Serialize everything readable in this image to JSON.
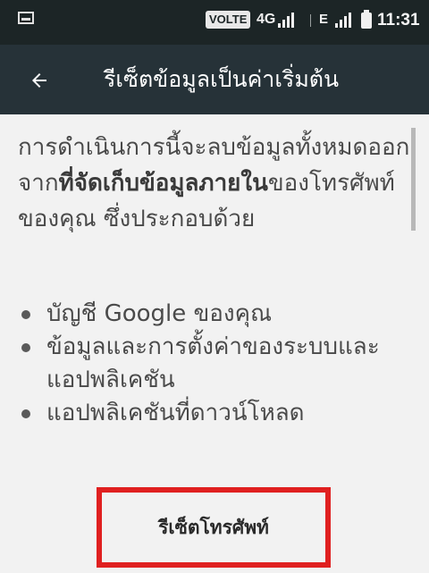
{
  "status_bar": {
    "volte": "VOLTE",
    "network": "4G",
    "network_secondary": "E",
    "time": "11:31",
    "icons": [
      "image-icon",
      "volte-icon",
      "signal-icon",
      "signal-icon",
      "battery-icon"
    ]
  },
  "app_bar": {
    "back_icon": "arrow-left-icon",
    "title": "รีเซ็ตข้อมูลเป็นค่าเริ่มต้น"
  },
  "content": {
    "intro_before": "การดำเนินการนี้จะลบข้อมูลทั้งหมดออกจาก",
    "intro_bold": "ที่จัดเก็บข้อมูลภายใน",
    "intro_after": "ของโทรศัพท์ของคุณ ซึ่งประกอบด้วย",
    "items": [
      "บัญชี Google ของคุณ",
      "ข้อมูลและการตั้งค่าของระบบและแอปพลิเคชัน",
      "แอปพลิเคชันที่ดาวน์โหลด"
    ],
    "reset_button_label": "รีเซ็ตโทรศัพท์",
    "highlight_color": "#e02020"
  },
  "colors": {
    "status_bar_bg": "#1c2526",
    "app_bar_bg": "#263238",
    "content_bg": "#f2f2f2"
  }
}
